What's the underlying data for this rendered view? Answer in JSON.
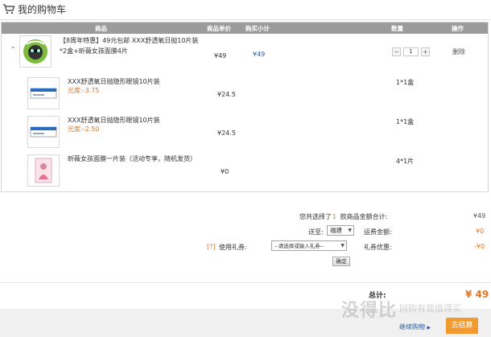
{
  "header": {
    "title": "我的购物车",
    "cart_icon": "cart-icon"
  },
  "table": {
    "columns": [
      "商品",
      "商品单价",
      "购买小计",
      "数量",
      "操作"
    ]
  },
  "bundle": {
    "collapse_icon": "chevron-up-icon",
    "title_line1": "【8周年特惠】49元包邮 XXX舒透氧日抛10片装",
    "title_line2": "*2盒+昕薇女孩面膜4片",
    "price": "¥49",
    "subtotal": "¥49",
    "quantity": "1",
    "minus": "−",
    "plus": "+",
    "delete_label": "删除",
    "items": [
      {
        "name": "XXX舒透氧日抛隐形眼镜10片装",
        "spec": "光度:-3.75",
        "price": "¥24.5",
        "qty": "1*1盒"
      },
      {
        "name": "XXX舒透氧日抛隐形眼镜10片装",
        "spec": "光度:-2.50",
        "price": "¥24.5",
        "qty": "1*1盒"
      },
      {
        "name": "昕薇女孩面膜一片装（活动专享，随机发货）",
        "spec": "",
        "price": "¥0",
        "qty": "4*1片"
      }
    ]
  },
  "summary": {
    "selected_prefix": "您共选择了",
    "selected_count": "1",
    "selected_suffix": "款商品金额合计:",
    "amount": "¥49",
    "ship_to_label": "送至:",
    "ship_to_value": "福建",
    "freight_label": "运费金额:",
    "freight": "¥0",
    "coupon_help": "[?]",
    "coupon_label": "使用礼券:",
    "coupon_placeholder": "--请选择或输入礼券--",
    "coupon_discount_label": "礼券优惠:",
    "coupon_discount": "-¥0",
    "confirm_label": "确定"
  },
  "footer": {
    "total_label": "总计:",
    "total_value": "¥ 49",
    "continue_label": "继续购物",
    "continue_arrow": "▶",
    "checkout_label": "去结算",
    "watermark_main": "没得比",
    "watermark_sub": "网购有我值得买"
  },
  "colors": {
    "accent": "#e7741b",
    "link": "#2a5aa8",
    "header_bg": "#9b9b9b",
    "checkout_bg": "#f39a2e"
  }
}
